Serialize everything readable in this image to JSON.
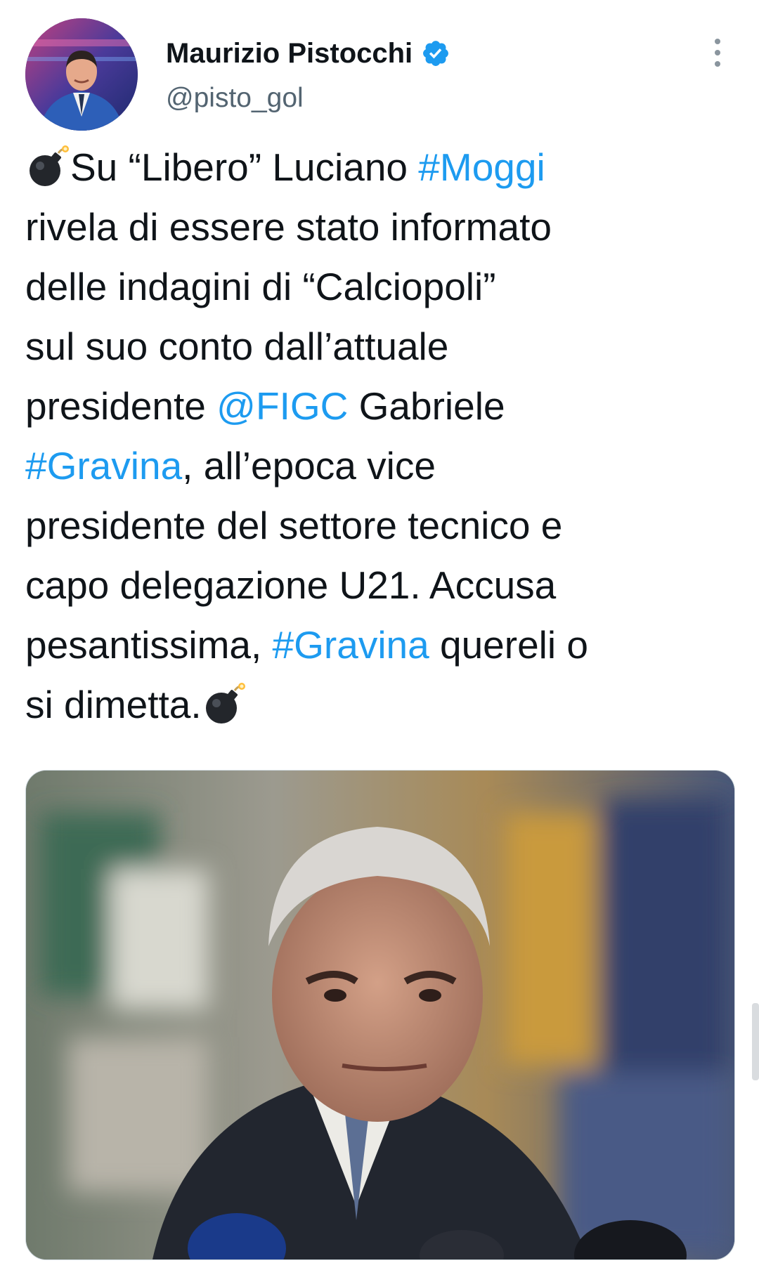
{
  "author": {
    "display_name": "Maurizio Pistocchi",
    "handle": "@pisto_gol",
    "verified": true,
    "avatar_icon": "profile-photo"
  },
  "tweet": {
    "segments": [
      {
        "type": "emoji",
        "icon": "bomb-icon"
      },
      {
        "type": "text",
        "text": "Su “Libero” Luciano "
      },
      {
        "type": "link",
        "text": "#Moggi"
      },
      {
        "type": "text",
        "text": "\nrivela di essere stato informato\ndelle indagini di “Calciopoli”\nsul suo conto dall’attuale\npresidente "
      },
      {
        "type": "link",
        "text": "@FIGC"
      },
      {
        "type": "text",
        "text": " Gabriele\n"
      },
      {
        "type": "link",
        "text": "#Gravina"
      },
      {
        "type": "text",
        "text": ", all’epoca vice\npresidente del settore tecnico e\ncapo delegazione U21. Accusa\npesantissima, "
      },
      {
        "type": "link",
        "text": "#Gravina"
      },
      {
        "type": "text",
        "text": " quereli o\nsi dimetta."
      },
      {
        "type": "emoji",
        "icon": "bomb-icon"
      }
    ]
  },
  "media": {
    "kind": "photo",
    "icon": "portrait-photo"
  },
  "colors": {
    "link": "#1d9bf0",
    "text": "#0f1419",
    "secondary": "#536471",
    "verified_badge": "#1d9bf0"
  }
}
